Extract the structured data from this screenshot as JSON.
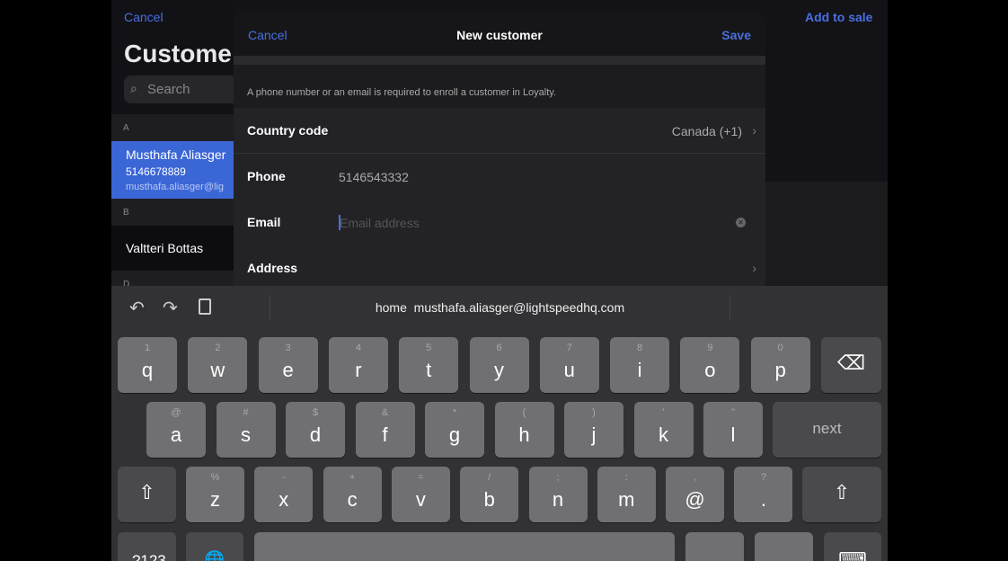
{
  "background": {
    "cancel_label": "Cancel",
    "add_to_sale_label": "Add to sale",
    "title": "Custome",
    "search_placeholder": "Search",
    "sections": [
      {
        "letter": "A",
        "customers": [
          {
            "name": "Musthafa Aliasger",
            "phone": "5146678889",
            "email": "musthafa.aliasger@lig",
            "selected": true
          }
        ]
      },
      {
        "letter": "B",
        "customers": [
          {
            "name": "Valtteri Bottas"
          }
        ]
      },
      {
        "letter": "D"
      }
    ]
  },
  "modal": {
    "cancel_label": "Cancel",
    "title": "New customer",
    "save_label": "Save",
    "info_text": "A phone number or an email is required to enroll a customer in Loyalty.",
    "fields": {
      "country_code": {
        "label": "Country code",
        "value": "Canada (+1)"
      },
      "phone": {
        "label": "Phone",
        "value": "5146543332"
      },
      "email": {
        "label": "Email",
        "value": "",
        "placeholder": "Email address"
      },
      "address": {
        "label": "Address"
      }
    }
  },
  "keyboard": {
    "suggestion": "home  musthafa.aliasger@lightspeedhq.com",
    "row1": [
      [
        "1",
        "q"
      ],
      [
        "2",
        "w"
      ],
      [
        "3",
        "e"
      ],
      [
        "4",
        "r"
      ],
      [
        "5",
        "t"
      ],
      [
        "6",
        "y"
      ],
      [
        "7",
        "u"
      ],
      [
        "8",
        "i"
      ],
      [
        "9",
        "o"
      ],
      [
        "0",
        "p"
      ]
    ],
    "row2": [
      [
        "@",
        "a"
      ],
      [
        "#",
        "s"
      ],
      [
        "$",
        "d"
      ],
      [
        "&",
        "f"
      ],
      [
        "*",
        "g"
      ],
      [
        "(",
        "h"
      ],
      [
        ")",
        "j"
      ],
      [
        "'",
        "k"
      ],
      [
        "\"",
        "l"
      ]
    ],
    "row3": [
      [
        "%",
        "z"
      ],
      [
        "-",
        "x"
      ],
      [
        "+",
        "c"
      ],
      [
        "=",
        "v"
      ],
      [
        "/",
        "b"
      ],
      [
        ";",
        "n"
      ],
      [
        ":",
        "m"
      ],
      [
        ",",
        "@"
      ],
      [
        "?",
        "."
      ]
    ],
    "next_label": "next",
    "numbers_label": ".?123",
    "accent": "#4a6fe0"
  }
}
